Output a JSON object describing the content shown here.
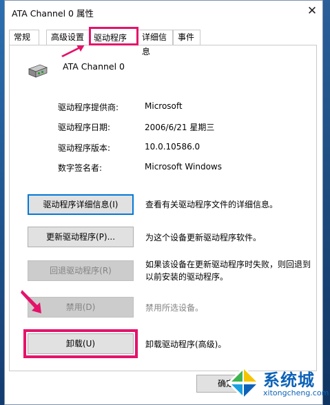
{
  "window": {
    "title": "ATA Channel 0 属性",
    "close_glyph": "✕"
  },
  "tabs": [
    {
      "label": "常规"
    },
    {
      "label": "高级设置"
    },
    {
      "label": "驱动程序"
    },
    {
      "label": "详细信息"
    },
    {
      "label": "事件"
    }
  ],
  "device": {
    "name": "ATA Channel 0"
  },
  "properties": [
    {
      "label": "驱动程序提供商:",
      "value": "Microsoft"
    },
    {
      "label": "驱动程序日期:",
      "value": "2006/6/21 星期三"
    },
    {
      "label": "驱动程序版本:",
      "value": "10.0.10586.0"
    },
    {
      "label": "数字签名者:",
      "value": "Microsoft Windows"
    }
  ],
  "actions": [
    {
      "button": "驱动程序详细信息(I)",
      "description": "查看有关驱动程序文件的详细信息。",
      "enabled": true
    },
    {
      "button": "更新驱动程序(P)...",
      "description": "为这个设备更新驱动程序软件。",
      "enabled": true
    },
    {
      "button": "回退驱动程序(R)",
      "description_line1": "如果该设备在更新驱动程序时失败，则回退到",
      "description_line2": "以前安装的驱动程序。",
      "enabled": false
    },
    {
      "button": "禁用(D)",
      "description": "禁用所选设备。",
      "enabled": false
    },
    {
      "button": "卸载(U)",
      "description": "卸载驱动程序(高级)。",
      "enabled": true
    }
  ],
  "footer": {
    "ok_label": "确定"
  },
  "watermark": {
    "text": "系统城",
    "url": "xitongcheng.com"
  },
  "colors": {
    "highlight": "#e5126a",
    "focus": "#0078d7",
    "watermark": "#0d62b8"
  }
}
